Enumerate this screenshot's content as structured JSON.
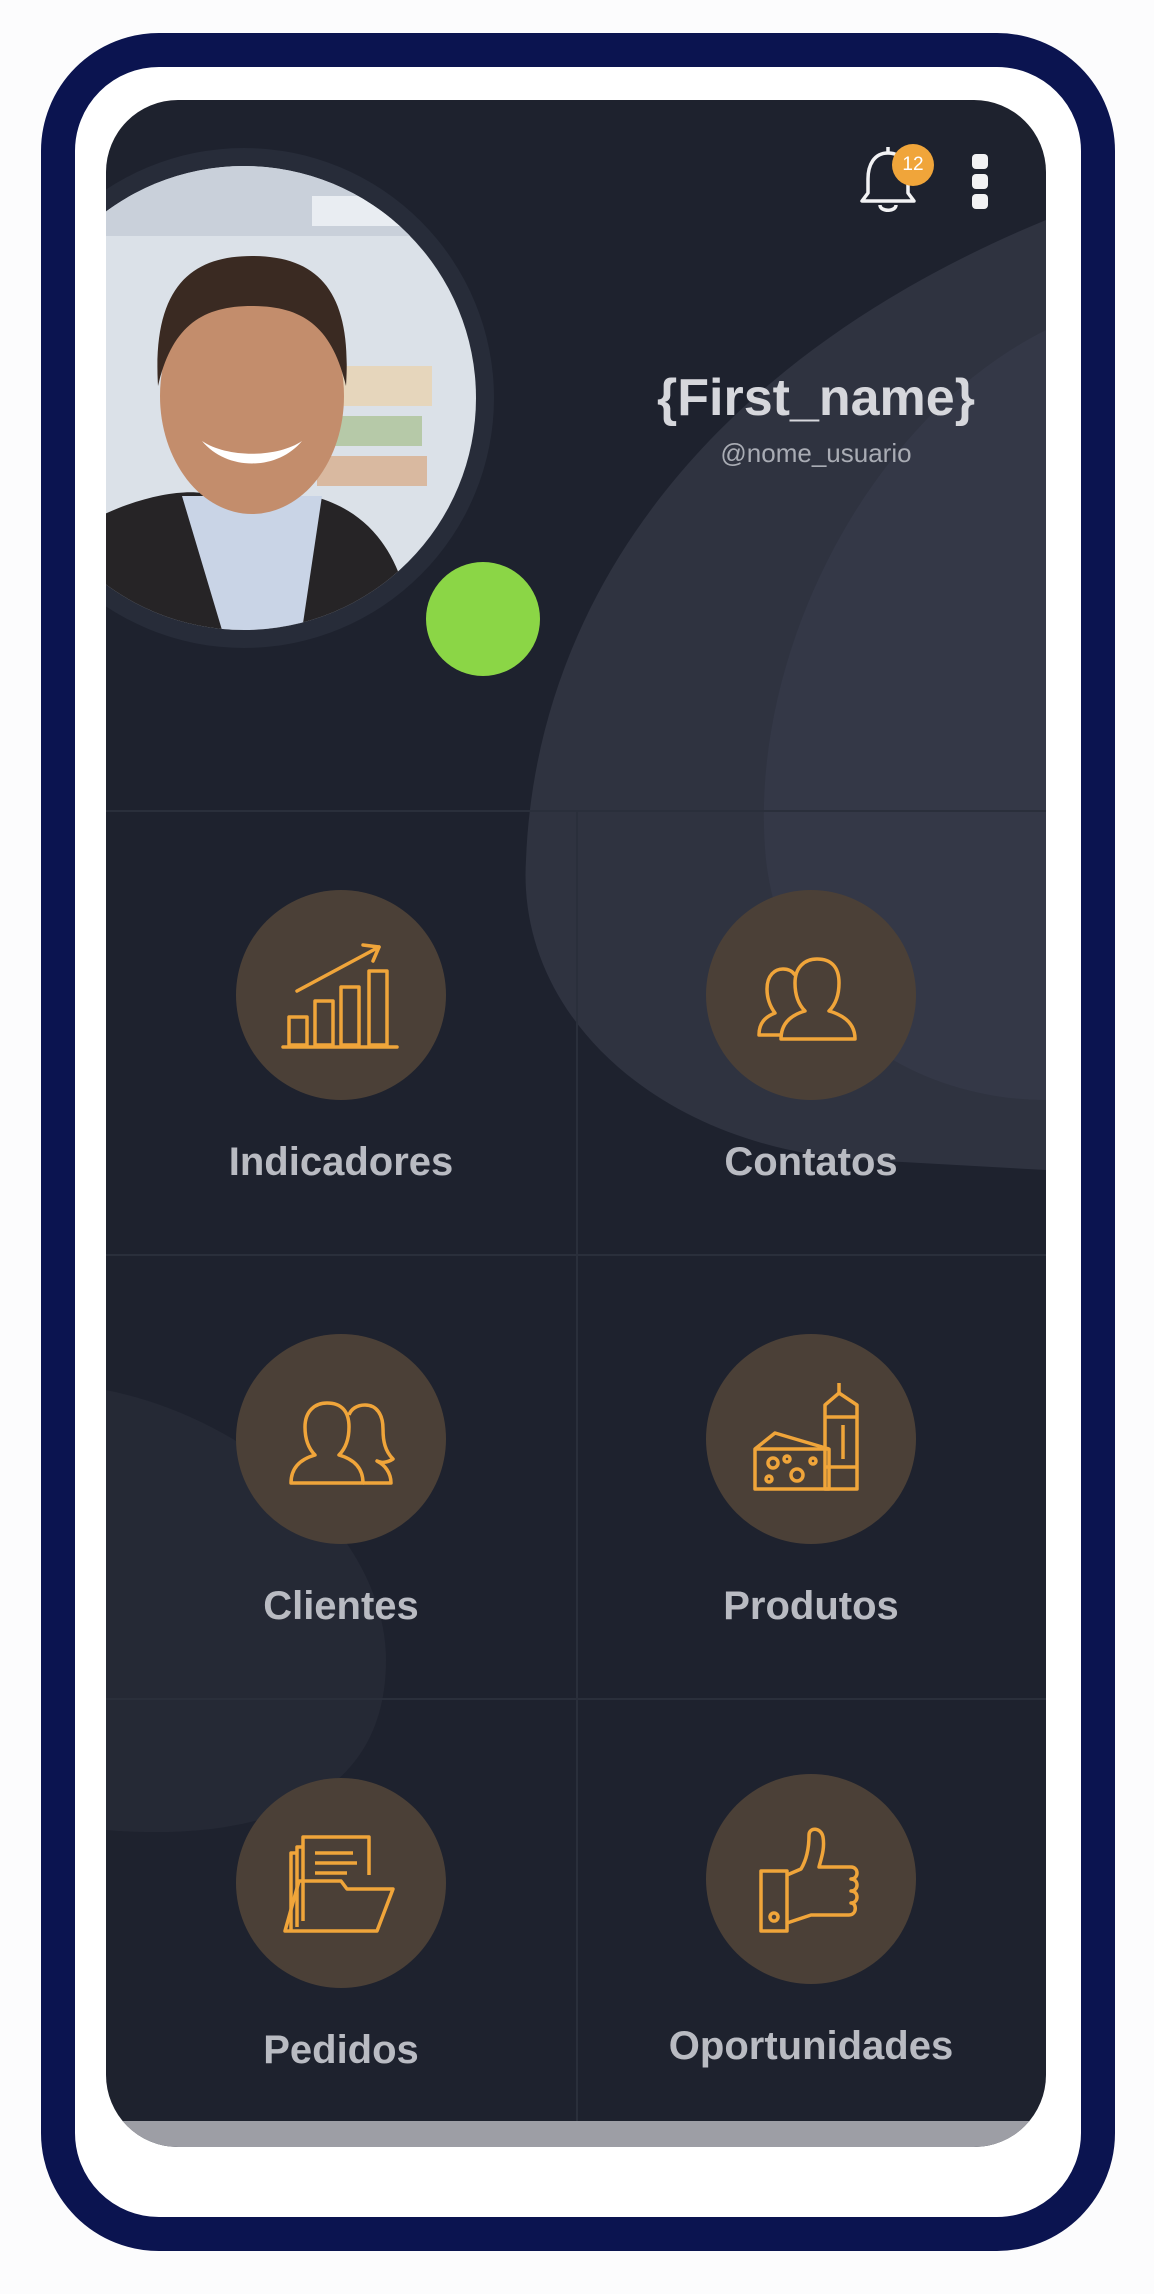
{
  "profile": {
    "first_name": "{First_name}",
    "username": "@nome_usuario",
    "online": true
  },
  "notifications": {
    "count": "12",
    "icon": "bell-icon"
  },
  "menu": {
    "icon": "kebab-menu-icon"
  },
  "tiles": [
    {
      "label": "Indicadores",
      "icon": "bar-chart-trend-icon"
    },
    {
      "label": "Contatos",
      "icon": "contacts-icon"
    },
    {
      "label": "Clientes",
      "icon": "clients-icon"
    },
    {
      "label": "Produtos",
      "icon": "products-icon"
    },
    {
      "label": "Pedidos",
      "icon": "folder-documents-icon"
    },
    {
      "label": "Oportunidades",
      "icon": "thumbs-up-icon"
    }
  ],
  "colors": {
    "frame": "#0b1450",
    "screen_bg": "#1e222e",
    "accent_orange": "#f0a53a",
    "icon_circle": "#4b4037",
    "online_green": "#8bd646",
    "label_text": "#b9bbc2"
  }
}
